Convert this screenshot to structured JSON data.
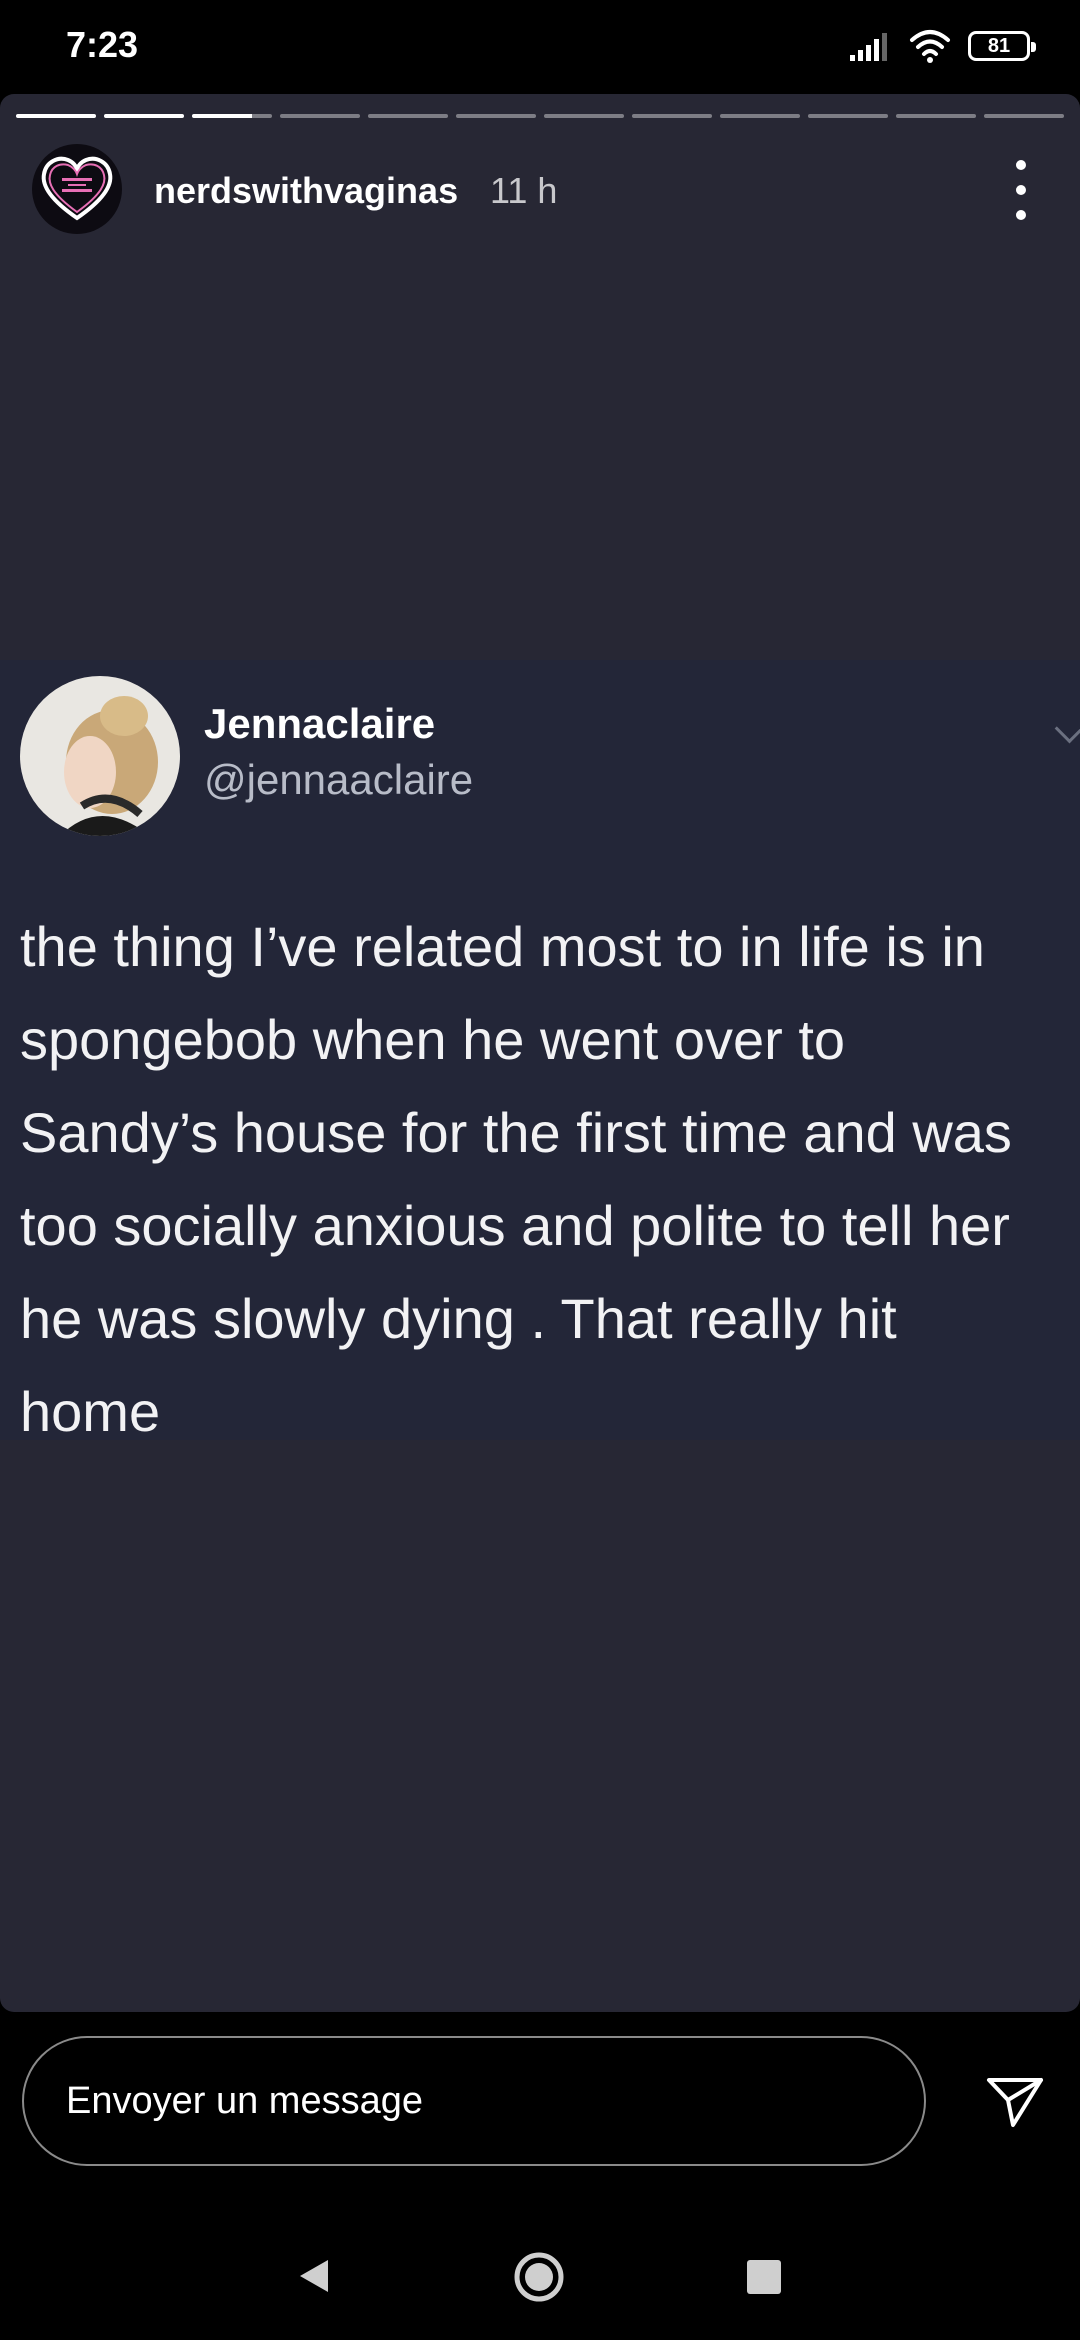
{
  "status_bar": {
    "time": "7:23",
    "battery": "81"
  },
  "story": {
    "account_name": "nerdswithvaginas",
    "time_ago": "11 h",
    "segments_total": 12,
    "segments_complete": 2,
    "current_segment_progress": 0.75
  },
  "tweet": {
    "name": "Jennaclaire",
    "handle": "@jennaaclaire",
    "lines": [
      "the thing I’ve related most to in life is in",
      "spongebob when he went over to",
      "Sandy’s house for the first time and was",
      "too socially anxious and polite to tell her",
      "he was slowly dying .  That really hit",
      "home"
    ]
  },
  "message_bar": {
    "placeholder": "Envoyer un message"
  },
  "colors": {
    "story_background": "#272734",
    "tweet_background": "#232638",
    "accent_heart": "#e86fb5"
  }
}
